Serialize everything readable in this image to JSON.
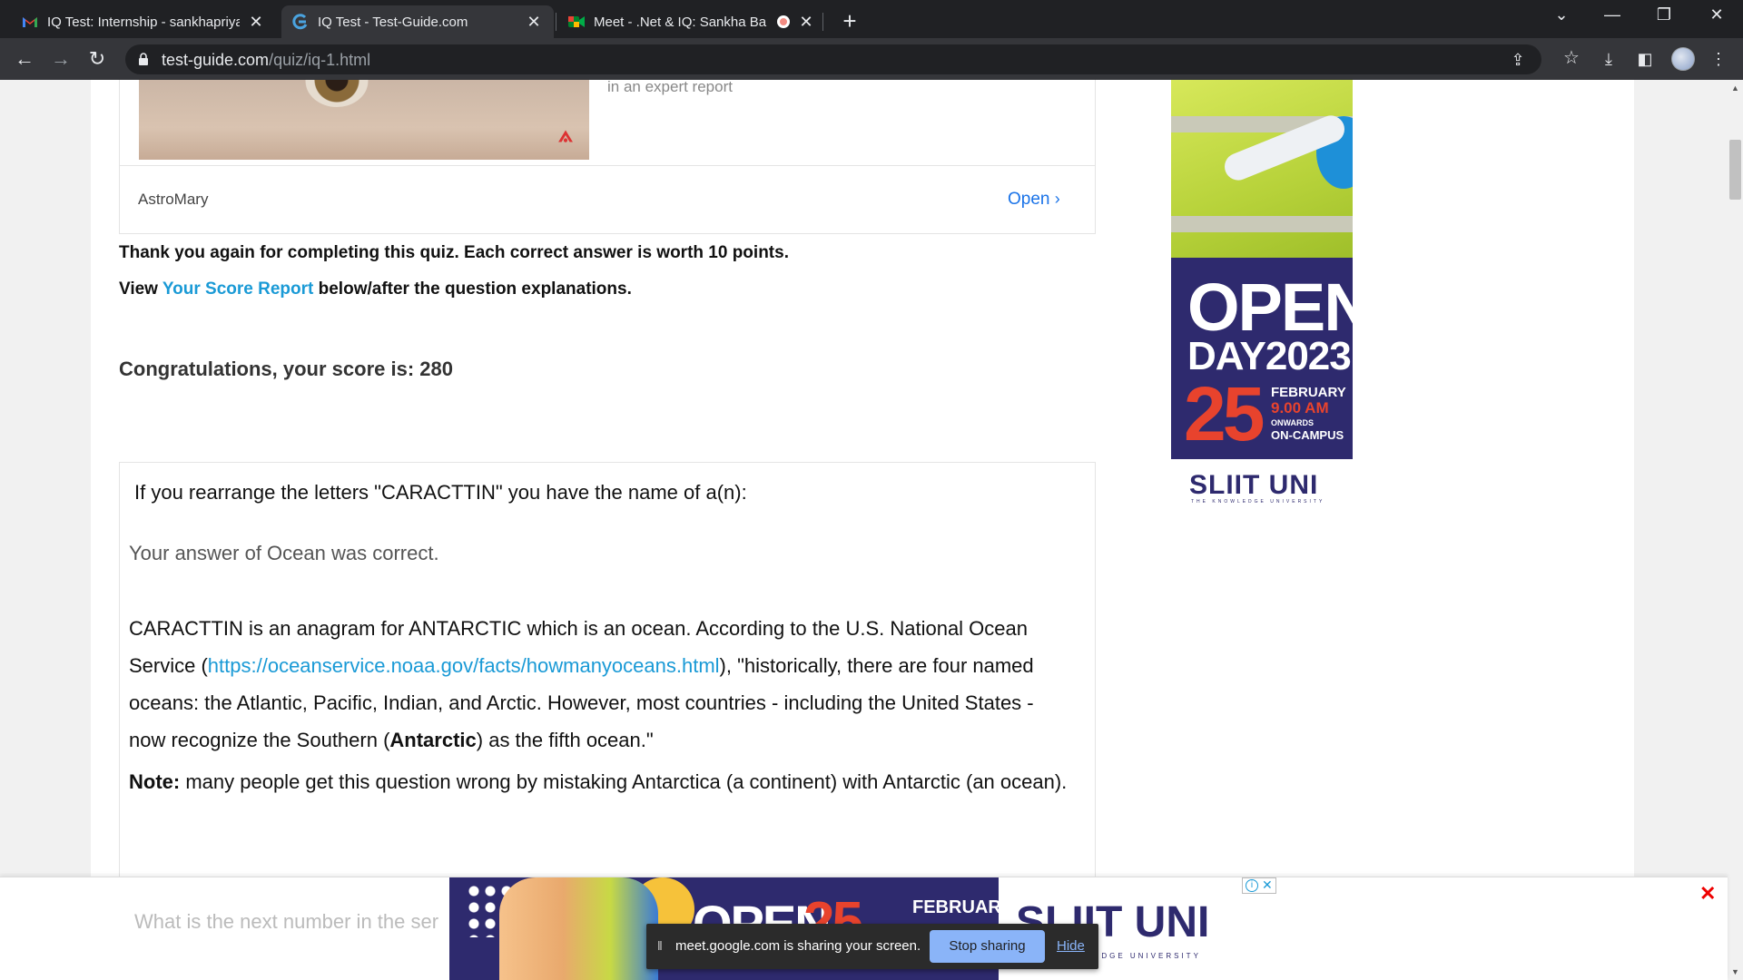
{
  "browser": {
    "tabs": [
      {
        "title": "IQ Test: Internship - sankhapriyan",
        "icon": "gmail-icon",
        "active": false
      },
      {
        "title": "IQ Test - Test-Guide.com",
        "icon": "test-guide-icon",
        "active": true
      },
      {
        "title": "Meet - .Net & IQ: Sankha Ba",
        "icon": "meet-icon",
        "active": false
      }
    ],
    "url_host": "test-guide.com",
    "url_path": "/quiz/iq-1.html"
  },
  "top_ad": {
    "text": "in an expert report",
    "brand": "AstroMary",
    "open_label": "Open"
  },
  "quiz": {
    "thank_you": "Thank you again for completing this quiz. Each correct answer is worth 10 points.",
    "view_prefix": "View ",
    "view_link": "Your Score Report",
    "view_suffix": " below/after the question explanations.",
    "score_text": "Congratulations, your score is: 280",
    "question": "If you rearrange the letters \"CARACTTIN\" you have the name of a(n):",
    "answer_feedback": "Your answer of Ocean was correct.",
    "explanation_1": "CARACTTIN is an anagram for ANTARCTIC which is an ocean. According to the U.S. National Ocean Service (",
    "explanation_link": "https://oceanservice.noaa.gov/facts/howmanyoceans.html",
    "explanation_2": "), \"historically, there are four named oceans: the Atlantic, Pacific, Indian, and Arctic. However, most countries - including the United States - now recognize the Southern (",
    "explanation_bold": "Antarctic",
    "explanation_3": ") as the fifth ocean.\"",
    "note_label": "Note:",
    "note_text": " many people get this question wrong by mistaking Antarctica (a continent) with Antarctic (an ocean).",
    "next_question_partial": "What is the next number in the ser"
  },
  "side_ad": {
    "open": "OPEN",
    "day": "DAY2023",
    "date": "25",
    "month": "FEBRUARY",
    "time": "9.00 AM",
    "onwards": "ONWARDS",
    "campus": "ON-CAMPUS",
    "brand": "SLIIT UNI",
    "brand_sub": "THE KNOWLEDGE UNIVERSITY"
  },
  "bottom_ad": {
    "open": "OPEN",
    "date": "25",
    "month": "FEBRUARY",
    "brand": "SLIIT UNI",
    "brand_sub": "EDGE UNIVERSITY"
  },
  "share_bar": {
    "message": "meet.google.com is sharing your screen.",
    "stop_label": "Stop sharing",
    "hide_label": "Hide"
  },
  "colors": {
    "link": "#1a9ad6",
    "ad_navy": "#2e2a6e",
    "ad_red": "#e8432d"
  }
}
